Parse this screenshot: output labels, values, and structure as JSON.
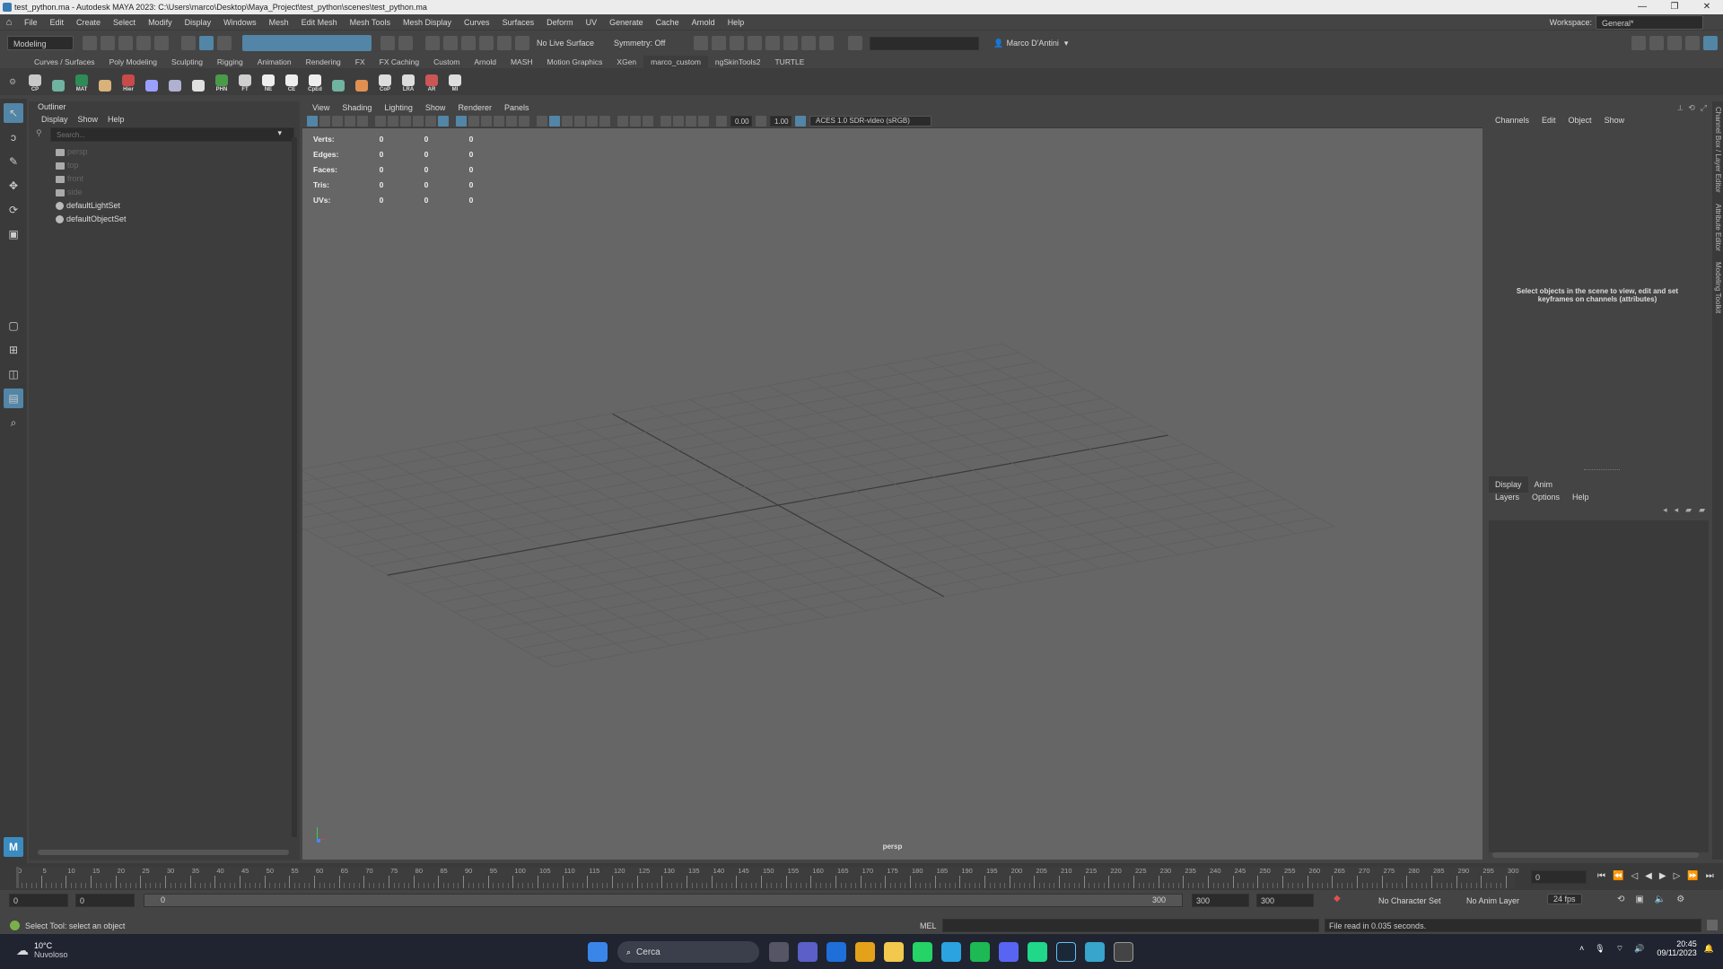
{
  "titlebar": {
    "title": "test_python.ma - Autodesk MAYA 2023: C:\\Users\\marco\\Desktop\\Maya_Project\\test_python\\scenes\\test_python.ma"
  },
  "menubar": {
    "items": [
      "File",
      "Edit",
      "Create",
      "Select",
      "Modify",
      "Display",
      "Windows",
      "Mesh",
      "Edit Mesh",
      "Mesh Tools",
      "Mesh Display",
      "Curves",
      "Surfaces",
      "Deform",
      "UV",
      "Generate",
      "Cache",
      "Arnold",
      "Help"
    ],
    "workspace_label": "Workspace:",
    "workspace_value": "General*"
  },
  "toolbar": {
    "mode": "Modeling",
    "live_surface": "No Live Surface",
    "symmetry": "Symmetry: Off",
    "user": "Marco D'Antini"
  },
  "shelf": {
    "tabs": [
      "Curves / Surfaces",
      "Poly Modeling",
      "Sculpting",
      "Rigging",
      "Animation",
      "Rendering",
      "FX",
      "FX Caching",
      "Custom",
      "Arnold",
      "MASH",
      "Motion Graphics",
      "XGen",
      "marco_custom",
      "ngSkinTools2",
      "TURTLE"
    ],
    "active": "marco_custom",
    "icons": [
      {
        "label": "CP",
        "color": "#c8c8c8"
      },
      {
        "label": "",
        "color": "#6fb3a0"
      },
      {
        "label": "MAT",
        "color": "#2e8b57"
      },
      {
        "label": "",
        "color": "#d9b27a"
      },
      {
        "label": "Hier",
        "color": "#c84a4a"
      },
      {
        "label": "",
        "color": "#9aa0ff"
      },
      {
        "label": "",
        "color": "#b0b0d0"
      },
      {
        "label": "",
        "color": "#e0e0e0"
      },
      {
        "label": "PHN",
        "color": "#4a9a4a"
      },
      {
        "label": "FT",
        "color": "#cfcfcf"
      },
      {
        "label": "NE",
        "color": "#eeeeee"
      },
      {
        "label": "CE",
        "color": "#eeeeee"
      },
      {
        "label": "CpEd",
        "color": "#eeeeee"
      },
      {
        "label": "",
        "color": "#6fb3a0"
      },
      {
        "label": "",
        "color": "#e09050"
      },
      {
        "label": "CoP",
        "color": "#dddddd"
      },
      {
        "label": "LRA",
        "color": "#dddddd"
      },
      {
        "label": "AR",
        "color": "#cc5555"
      },
      {
        "label": "MI",
        "color": "#dddddd"
      }
    ]
  },
  "outliner": {
    "title": "Outliner",
    "menu": [
      "Display",
      "Show",
      "Help"
    ],
    "search_placeholder": "Search...",
    "items": [
      {
        "label": "persp",
        "dim": true
      },
      {
        "label": "top",
        "dim": true
      },
      {
        "label": "front",
        "dim": true
      },
      {
        "label": "side",
        "dim": true
      },
      {
        "label": "defaultLightSet",
        "dim": false
      },
      {
        "label": "defaultObjectSet",
        "dim": false
      }
    ]
  },
  "viewport": {
    "menu": [
      "View",
      "Shading",
      "Lighting",
      "Show",
      "Renderer",
      "Panels"
    ],
    "exposure": "0.00",
    "gamma": "1.00",
    "colorspace": "ACES 1.0 SDR-video (sRGB)",
    "camera": "persp",
    "hud": [
      {
        "label": "Verts:",
        "vals": [
          "0",
          "0",
          "0"
        ]
      },
      {
        "label": "Edges:",
        "vals": [
          "0",
          "0",
          "0"
        ]
      },
      {
        "label": "Faces:",
        "vals": [
          "0",
          "0",
          "0"
        ]
      },
      {
        "label": "Tris:",
        "vals": [
          "0",
          "0",
          "0"
        ]
      },
      {
        "label": "UVs:",
        "vals": [
          "0",
          "0",
          "0"
        ]
      }
    ]
  },
  "channelbox": {
    "menu": [
      "Channels",
      "Edit",
      "Object",
      "Show"
    ],
    "message": "Select objects in the scene to view, edit and set keyframes on channels (attributes)",
    "layer_tabs": [
      "Display",
      "Anim"
    ],
    "layer_menu": [
      "Layers",
      "Options",
      "Help"
    ]
  },
  "sidetabs": [
    "Channel Box / Layer Editor",
    "Attribute Editor",
    "Modeling Toolkit"
  ],
  "timeline": {
    "ticks": [
      "0",
      "5",
      "10",
      "15",
      "20",
      "25",
      "30",
      "35",
      "40",
      "45",
      "50",
      "55",
      "60",
      "65",
      "70",
      "75",
      "80",
      "85",
      "90",
      "95",
      "100",
      "105",
      "110",
      "115",
      "120",
      "125",
      "130",
      "135",
      "140",
      "145",
      "150",
      "155",
      "160",
      "165",
      "170",
      "175",
      "180",
      "185",
      "190",
      "195",
      "200",
      "205",
      "210",
      "215",
      "220",
      "225",
      "230",
      "235",
      "240",
      "245",
      "250",
      "255",
      "260",
      "265",
      "270",
      "275",
      "280",
      "285",
      "290",
      "295",
      "300"
    ],
    "current": "0"
  },
  "range": {
    "start": "0",
    "anim_start": "0",
    "slider_start": "0",
    "slider_end": "300",
    "anim_end": "300",
    "end": "300",
    "char_set": "No Character Set",
    "anim_layer": "No Anim Layer",
    "fps": "24 fps"
  },
  "cmdline": {
    "help": "Select Tool: select an object",
    "lang": "MEL",
    "result": "File read in  0.035 seconds."
  },
  "taskbar": {
    "temp": "10°C",
    "weather": "Nuvoloso",
    "search": "Cerca",
    "time": "20:45",
    "date": "09/11/2023"
  }
}
